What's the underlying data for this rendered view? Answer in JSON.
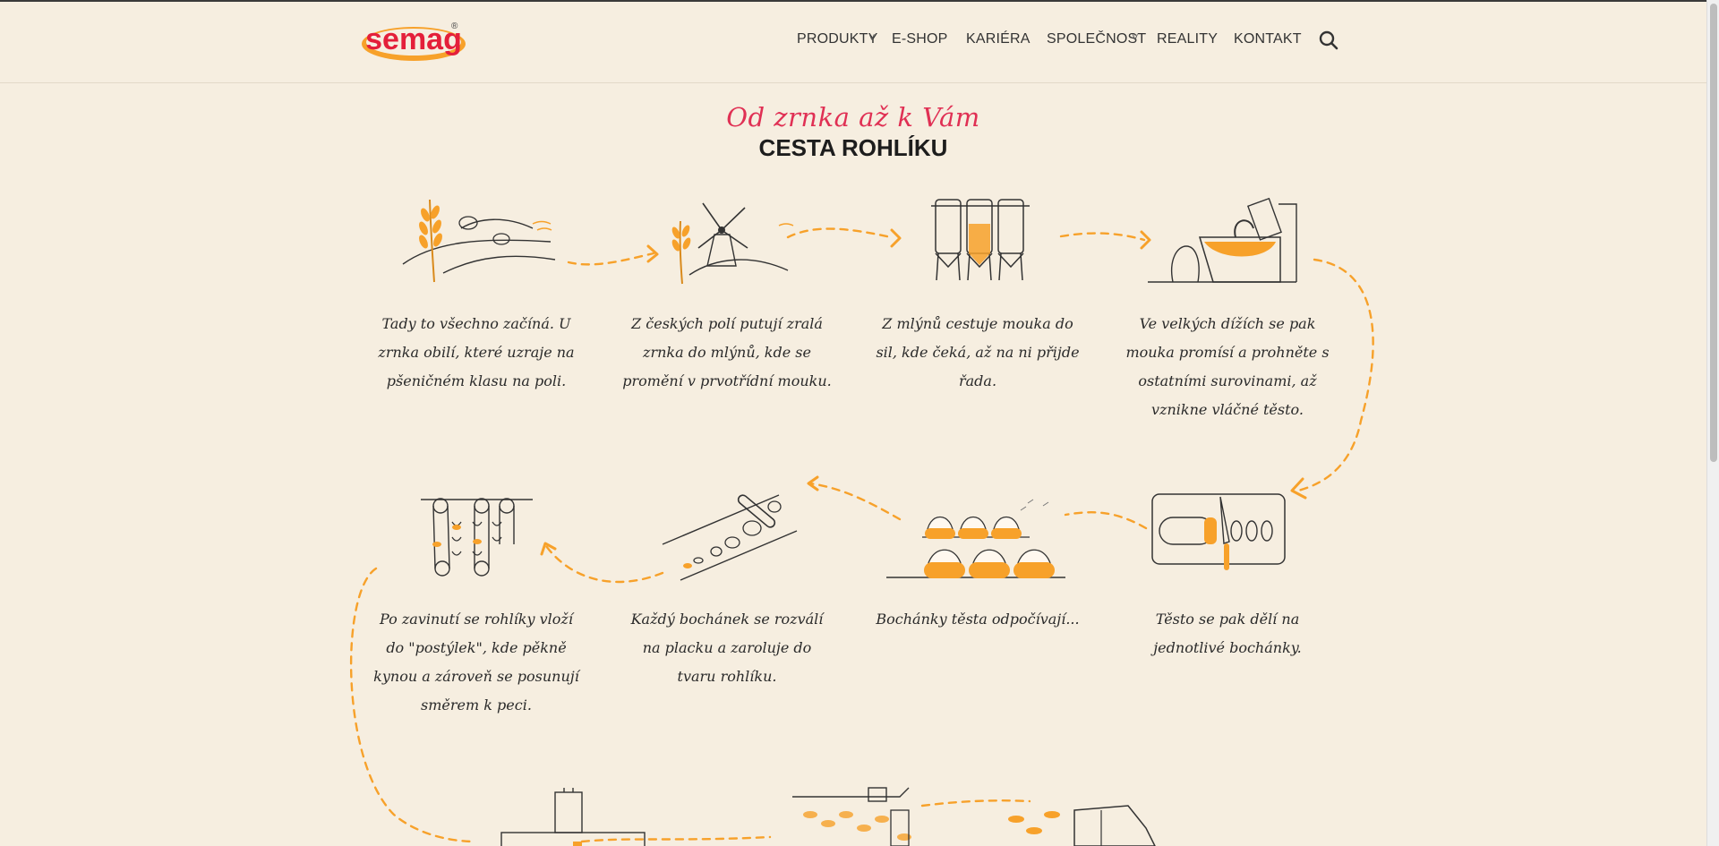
{
  "brand": {
    "name": "semag",
    "registered": "®"
  },
  "nav": {
    "items": [
      {
        "label": "PRODUKTY",
        "has_dropdown": true
      },
      {
        "label": "E-SHOP",
        "has_dropdown": false
      },
      {
        "label": "KARIÉRA",
        "has_dropdown": false
      },
      {
        "label": "SPOLEČNOST",
        "has_dropdown": true
      },
      {
        "label": "REALITY",
        "has_dropdown": false
      },
      {
        "label": "KONTAKT",
        "has_dropdown": false
      }
    ],
    "search_icon": "search-icon"
  },
  "hero": {
    "subtitle": "Od zrnka až k Vám",
    "title": "CESTA ROHLÍKU"
  },
  "steps": [
    {
      "text": "Tady to všechno začíná. U zrnka obilí, které uzraje na pšeničném klasu na poli.",
      "icon": "wheat-field-icon"
    },
    {
      "text": "Z českých polí putují zralá zrnka do mlýnů, kde se promění v prvotřídní mouku.",
      "icon": "windmill-icon"
    },
    {
      "text": "Z mlýnů cestuje mouka do sil, kde čeká, až na ni přijde řada.",
      "icon": "silos-icon"
    },
    {
      "text": "Ve velkých dížích se pak mouka promísí a prohněte s ostatními surovinami, až vznikne vláčné těsto.",
      "icon": "dough-mixer-icon"
    },
    {
      "text": "Po zavinutí se rohlíky vloží do \"postýlek\", kde pěkně kynou a zároveň se posunují směrem k peci.",
      "icon": "proofing-conveyor-icon"
    },
    {
      "text": "Každý bochánek se rozválí na placku a zaroluje do tvaru rohlíku.",
      "icon": "rolling-pin-icon"
    },
    {
      "text": "Bochánky těsta odpočívají...",
      "icon": "resting-dough-icon"
    },
    {
      "text": "Těsto se pak dělí na jednotlivé bochánky.",
      "icon": "dough-cutting-icon"
    }
  ],
  "colors": {
    "accent": "#f7a12a",
    "brand_red": "#e03054",
    "background": "#f6eee0",
    "ink": "#2a2a2a"
  }
}
